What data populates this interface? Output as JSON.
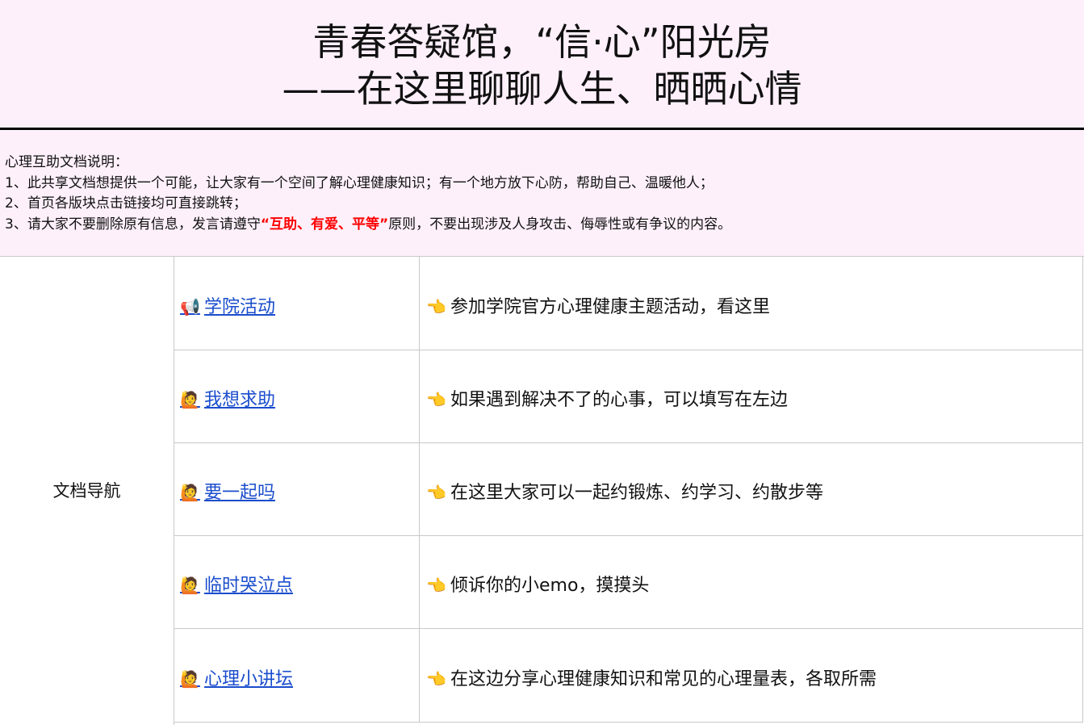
{
  "header": {
    "title_line1": "青春答疑馆，“信·心”阳光房",
    "title_line2": "——在这里聊聊人生、晒晒心情"
  },
  "notes": {
    "heading": "心理互助文档说明：",
    "item1": "1、此共享文档想提供一个可能，让大家有一个空间了解心理健康知识；有一个地方放下心防，帮助自己、温暖他人；",
    "item2": "2、首页各版块点击链接均可直接跳转；",
    "item3_prefix": "3、请大家不要删除原有信息，发言请遵守",
    "item3_emphasis": "“互助、有爱、平等”",
    "item3_suffix": "原则，不要出现涉及人身攻击、侮辱性或有争议的内容。"
  },
  "nav": {
    "label": "文档导航",
    "rows": [
      {
        "emoji": "📢",
        "link": "学院活动",
        "hand": "👈",
        "desc": "参加学院官方心理健康主题活动，看这里"
      },
      {
        "emoji": "🙋",
        "link": "我想求助",
        "hand": "👈",
        "desc": "如果遇到解决不了的心事，可以填写在左边"
      },
      {
        "emoji": "🙋",
        "link": "要一起吗",
        "hand": "👈",
        "desc": "在这里大家可以一起约锻炼、约学习、约散步等"
      },
      {
        "emoji": "🙋",
        "link": "临时哭泣点",
        "hand": "👈",
        "desc": "倾诉你的小emo，摸摸头"
      },
      {
        "emoji": "🙋",
        "link": "心理小讲坛",
        "hand": "👈",
        "desc": "在这边分享心理健康知识和常见的心理量表，各取所需"
      }
    ]
  },
  "colors": {
    "header_bg": "#fdf0fb",
    "link": "#1a4dcc",
    "emphasis": "#ff0000"
  }
}
